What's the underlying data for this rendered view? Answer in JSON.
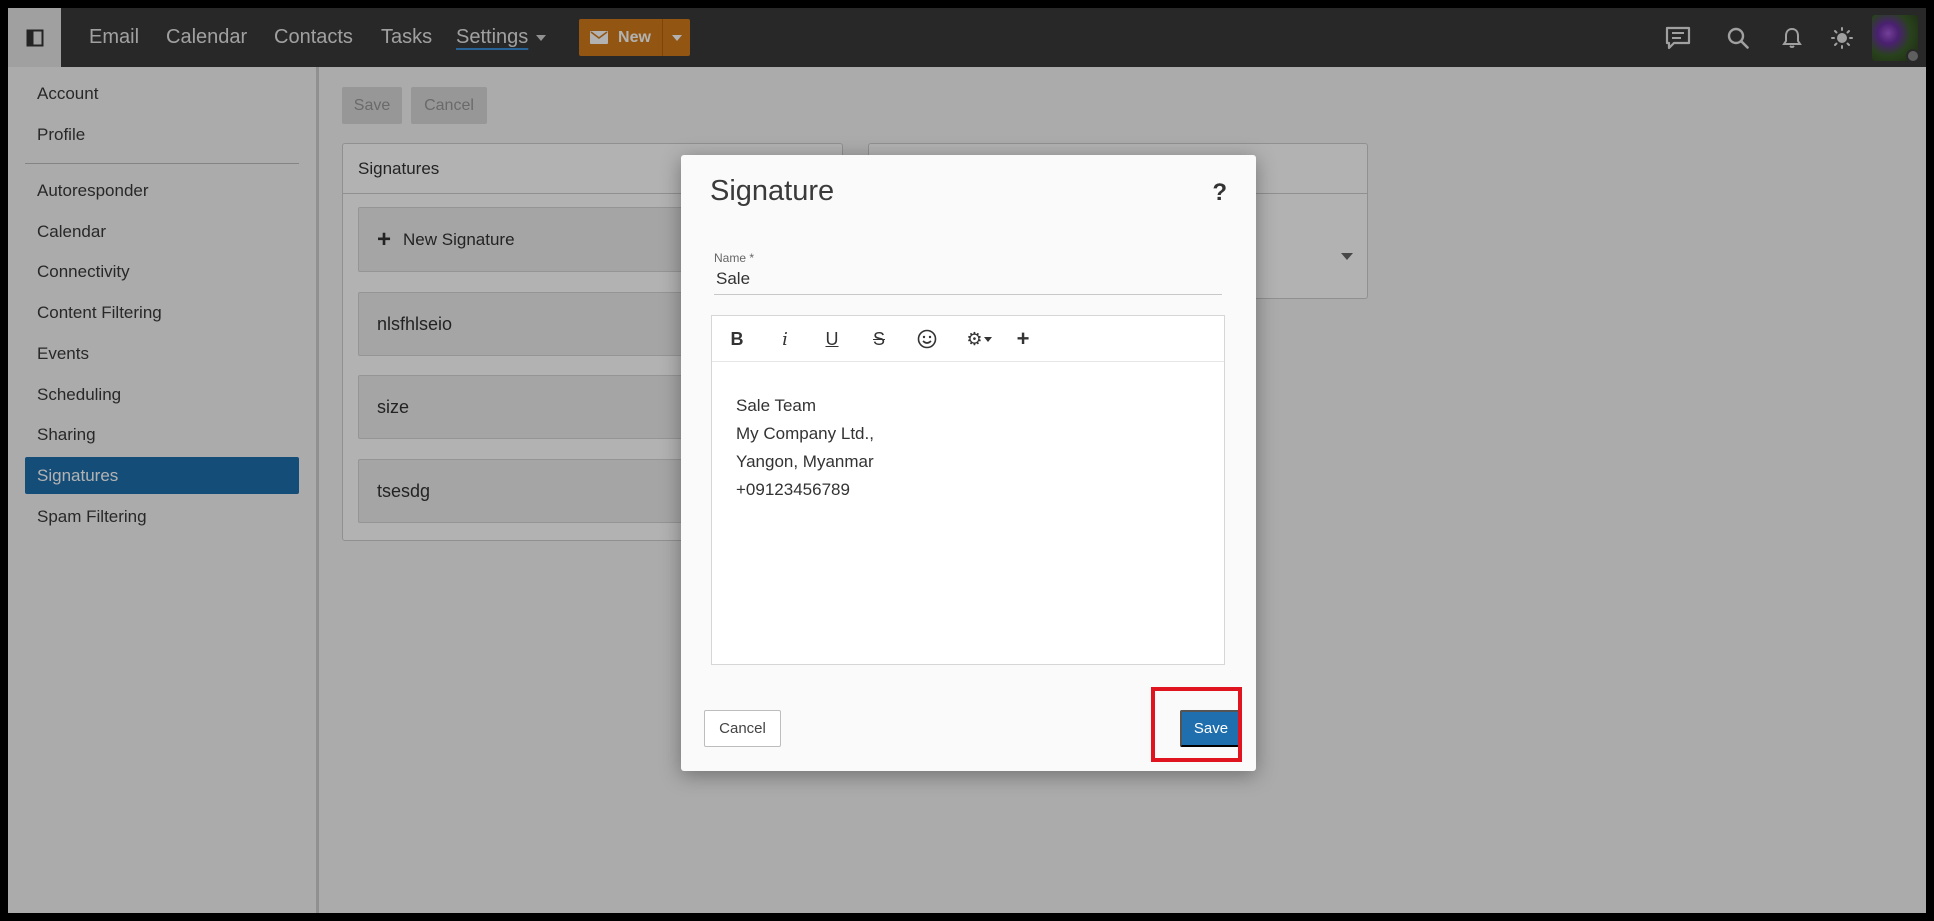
{
  "topbar": {
    "nav": [
      "Email",
      "Calendar",
      "Contacts",
      "Tasks"
    ],
    "settings_label": "Settings",
    "new_label": "New"
  },
  "icons": {
    "sidebar_toggle": "sidebar-toggle-icon",
    "chat": "chat-icon",
    "search": "search-icon",
    "bell": "bell-icon",
    "theme": "sun-icon"
  },
  "sidebar": {
    "items": [
      "Account",
      "Profile",
      "Autoresponder",
      "Calendar",
      "Connectivity",
      "Content Filtering",
      "Events",
      "Scheduling",
      "Sharing",
      "Signatures",
      "Spam Filtering"
    ],
    "active": "Signatures"
  },
  "main": {
    "save_label": "Save",
    "cancel_label": "Cancel",
    "panel_title": "Signatures",
    "new_signature_label": "New Signature",
    "signatures": [
      "nlsfhlseio",
      "size",
      "tsesdg"
    ]
  },
  "dialog": {
    "title": "Signature",
    "help": "?",
    "name_label": "Name *",
    "name_value": "Sale",
    "body_lines": [
      "Sale Team",
      "My Company Ltd.,",
      "Yangon, Myanmar",
      "+09123456789"
    ],
    "cancel_label": "Cancel",
    "save_label": "Save"
  },
  "colors": {
    "topbar_bg": "#3a3a3a",
    "accent_orange": "#d27b1a",
    "accent_blue": "#1f6fae",
    "highlight_red": "#e0141e"
  }
}
